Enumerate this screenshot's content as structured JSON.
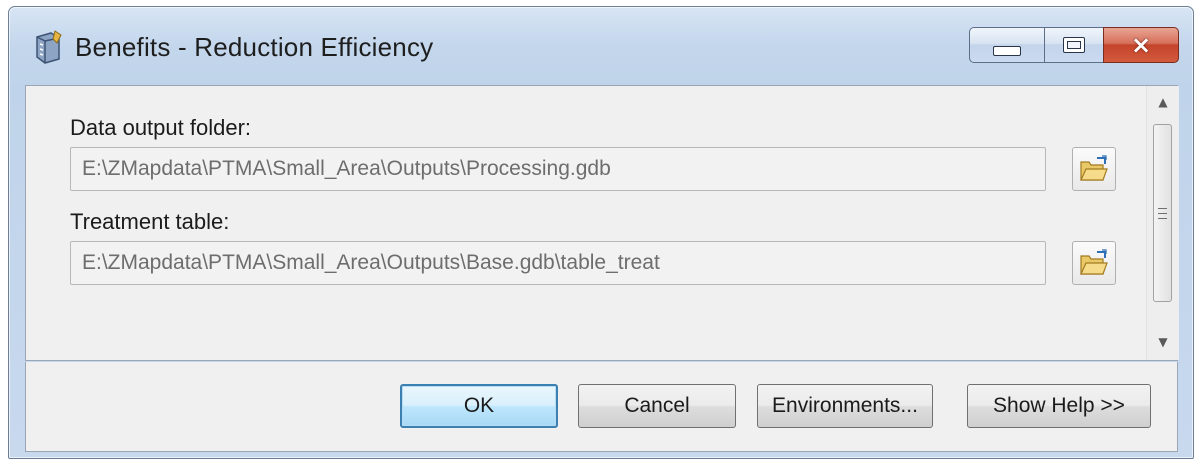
{
  "window": {
    "title": "Benefits - Reduction Efficiency",
    "icon": "toolbox-icon",
    "controls": {
      "minimize": "minimize-icon",
      "maximize": "maximize-icon",
      "close": "×"
    }
  },
  "params": [
    {
      "label": "Data output folder:",
      "value": "E:\\ZMapdata\\PTMA\\Small_Area\\Outputs\\Processing.gdb",
      "browse_icon": "folder-open-icon"
    },
    {
      "label": "Treatment table:",
      "value": "E:\\ZMapdata\\PTMA\\Small_Area\\Outputs\\Base.gdb\\table_treat",
      "browse_icon": "folder-open-icon"
    }
  ],
  "scrollbar": {
    "up": "▲",
    "down": "▼"
  },
  "buttons": {
    "ok": "OK",
    "cancel": "Cancel",
    "environments": "Environments...",
    "help": "Show Help >>"
  },
  "colors": {
    "title_bar": "#c3d6ec",
    "close_button": "#c4442a",
    "default_button_border": "#3c7fb1"
  }
}
